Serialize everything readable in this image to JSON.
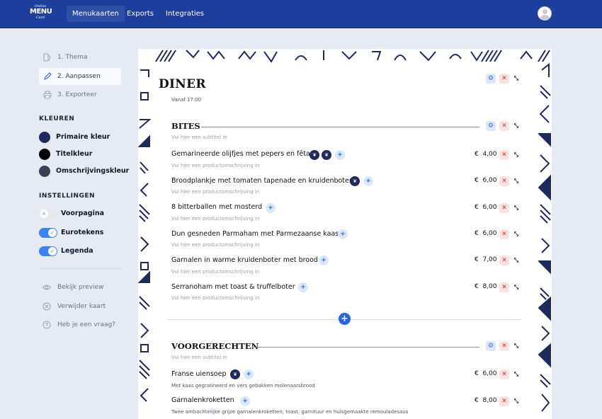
{
  "brand": {
    "logo_top": "Online",
    "logo_main": "MENU",
    "logo_bottom": "Card"
  },
  "nav": {
    "items": [
      {
        "label": "Menukaarten"
      },
      {
        "label": "Exports"
      },
      {
        "label": "Integraties"
      }
    ]
  },
  "sidebar": {
    "steps": [
      {
        "label": "1. Thema"
      },
      {
        "label": "2. Aanpassen"
      },
      {
        "label": "3. Exporteer"
      }
    ],
    "colors_heading": "KLEUREN",
    "colors": [
      {
        "label": "Primaire kleur",
        "color": "#1f2a5c"
      },
      {
        "label": "Titelkleur",
        "color": "#000000"
      },
      {
        "label": "Omschrijvingskleur",
        "color": "#374151"
      }
    ],
    "settings_heading": "INSTELLINGEN",
    "settings": [
      {
        "label": "Voorpagina",
        "on": false
      },
      {
        "label": "Eurotekens",
        "on": true
      },
      {
        "label": "Legenda",
        "on": true
      }
    ],
    "links": [
      {
        "label": "Bekijk preview"
      },
      {
        "label": "Verwijder kaart"
      },
      {
        "label": "Heb je een vraag?"
      }
    ]
  },
  "menu": {
    "title": "DINER",
    "subtitle": "Vanaf 17:00",
    "sections": [
      {
        "title": "BITES",
        "subtitle_placeholder": "Vul hier een subtitel in",
        "items": [
          {
            "name": "Gemarineerde olijfjes met pepers en fêta",
            "desc": "Vul hier een productomschrijving in",
            "currency": "€",
            "price": "4,00"
          },
          {
            "name": "Broodplankje met tomaten tapenade en kruidenboter",
            "desc": "Vul hier een productomschrijving in",
            "currency": "€",
            "price": "6,00"
          },
          {
            "name": "8 bitterballen met mosterd",
            "desc": "Vul hier een productomschrijving in",
            "currency": "€",
            "price": "6,00"
          },
          {
            "name": "Dun gesneden Parmaham met Parmezaanse kaas",
            "desc": "Vul hier een productomschrijving in",
            "currency": "€",
            "price": "6,00"
          },
          {
            "name": "Garnalen in warme kruidenboter met brood",
            "desc": "Vul hier een productomschrijving in",
            "currency": "€",
            "price": "7,00"
          },
          {
            "name": "Serranoham met toast & truffelboter",
            "desc": "Vul hier een productomschrijving in",
            "currency": "€",
            "price": "8,00"
          }
        ]
      },
      {
        "title": "VOORGERECHTEN",
        "subtitle_placeholder": "Vul hier een subtitel in",
        "items": [
          {
            "name": "Franse uiensoep",
            "desc": "Met kaas gegratineerd en vers gebakken molenaarsbrood",
            "currency": "€",
            "price": "6,00"
          },
          {
            "name": "Garnalenkroketten",
            "desc": "Twee ambachtelijke grijze garnalenkroketten, toast, garnituur en huisgemaakte remouladesaus",
            "currency": "€",
            "price": "8,00"
          }
        ]
      }
    ]
  },
  "icons": {
    "gear": "⚙",
    "close": "✕",
    "move": "⤡",
    "plus": "+",
    "leaf": "❦",
    "check": "✓",
    "cross": "×"
  },
  "colors": {
    "nav": "#1e3f9e",
    "accent": "#2563eb",
    "pattern": "#1f2a5c",
    "page": "#e6ebf3"
  }
}
